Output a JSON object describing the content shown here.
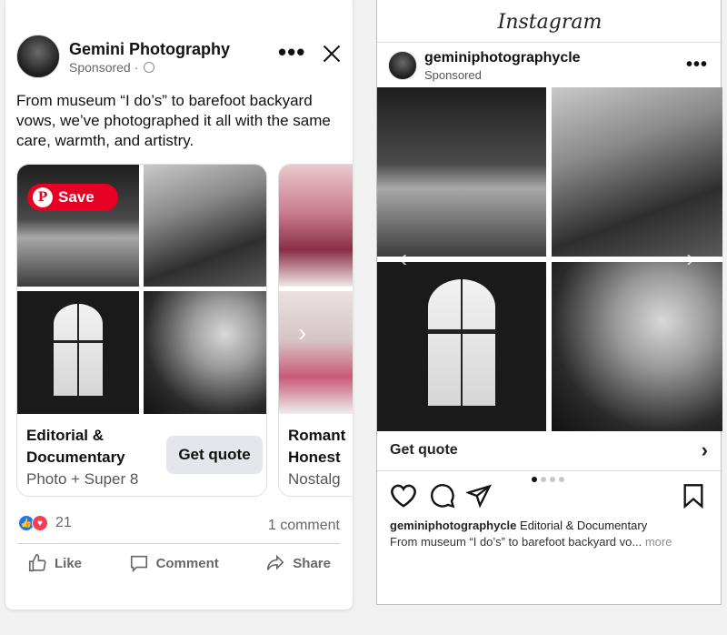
{
  "facebook": {
    "page_name": "Gemini Photography",
    "sponsored_label": "Sponsored ·",
    "more_icon": "more-horizontal-icon",
    "close_icon": "close-icon",
    "body_text": "From museum “I do’s” to barefoot backyard vows, we’ve photographed it all with the same care, warmth, and artistry.",
    "save_button": "Save",
    "pinterest_logo": "P",
    "carousel": [
      {
        "title": "Editorial & Documentary",
        "subtitle": "Photo + Super 8",
        "cta": "Get quote"
      },
      {
        "title": "Romant Honest",
        "subtitle": "Nostalg"
      }
    ],
    "reaction_count": "21",
    "comment_count": "1 comment",
    "actions": {
      "like": "Like",
      "comment": "Comment",
      "share": "Share"
    }
  },
  "instagram": {
    "logo": "Instagram",
    "username": "geminiphotographycle",
    "sponsored_label": "Sponsored",
    "cta": "Get quote",
    "carousel_position": {
      "current": 1,
      "total": 4
    },
    "caption_user": "geminiphotographycle",
    "caption_title": "Editorial & Documentary",
    "caption_text": "From museum “I do’s” to barefoot backyard vo...",
    "caption_more": "more"
  },
  "colors": {
    "pinterest_red": "#e60023",
    "fb_blue": "#1877f2",
    "love_red": "#f33e58"
  }
}
